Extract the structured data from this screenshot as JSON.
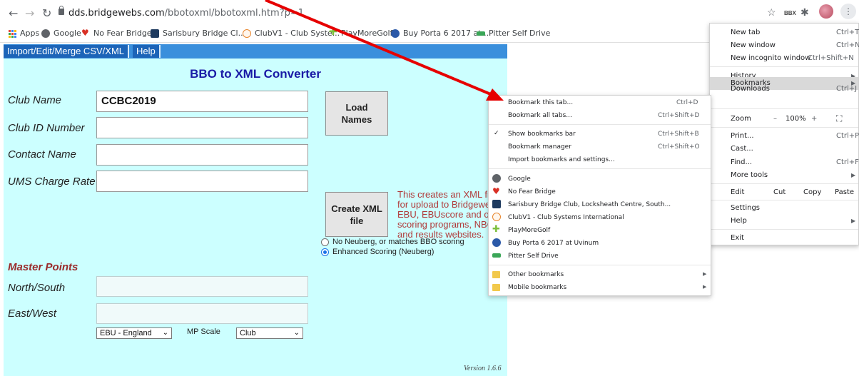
{
  "browser": {
    "url_host": "dds.bridgewebs.com",
    "url_path": "/bbotoxml/bbotoxml.htm?p=1",
    "extension_label": "BBX"
  },
  "bookmarks_bar": [
    {
      "label": "Apps",
      "icon": "apps-grid-icon",
      "color": "#4285f4"
    },
    {
      "label": "Google",
      "icon": "google-globe-icon",
      "color": "#5f6368"
    },
    {
      "label": "No Fear Bridge",
      "icon": "heart-icon",
      "color": "#d93025"
    },
    {
      "label": "Sarisbury Bridge Cl...",
      "icon": "club-logo-icon",
      "color": "#1e3a5f"
    },
    {
      "label": "ClubV1 - Club Syste...",
      "icon": "clubv1-logo-icon",
      "color": "#e8862e"
    },
    {
      "label": "PlayMoreGolf",
      "icon": "golf-cross-icon",
      "color": "#7cbf3c"
    },
    {
      "label": "Buy Porta 6 2017 at...",
      "icon": "uvinum-icon",
      "color": "#2b59a8"
    },
    {
      "label": "Pitter Self Drive",
      "icon": "pitter-icon",
      "color": "#3aa657"
    }
  ],
  "page": {
    "menu_tabs": [
      "Import/Edit/Merge CSV/XML",
      "Help"
    ],
    "title": "BBO to XML Converter",
    "fields": {
      "club_name": {
        "label": "Club Name",
        "value": "CCBC2019"
      },
      "club_id": {
        "label": "Club ID Number",
        "value": ""
      },
      "contact": {
        "label": "Contact Name",
        "value": ""
      },
      "ums": {
        "label": "UMS Charge Rate",
        "value": ""
      }
    },
    "load_names_label": "Load Names",
    "create_xml_label": "Create XML file",
    "info_lines": [
      "This creates an XML fil",
      "for upload to Bridgewe",
      "EBU, EBUscore and ot",
      "scoring programs, NBO",
      "and results websites."
    ],
    "scoring_options": [
      {
        "label": "No Neuberg, or matches BBO scoring",
        "selected": false
      },
      {
        "label": "Enhanced Scoring (Neuberg)",
        "selected": true
      }
    ],
    "master_points": {
      "heading": "Master Points",
      "ns_label": "North/South",
      "ew_label": "East/West",
      "region": "EBU - England",
      "mp_scale_label": "MP Scale",
      "mp_scale": "Club"
    },
    "version": "Version 1.6.6"
  },
  "chrome_menu": {
    "new_tab": {
      "label": "New tab",
      "key": "Ctrl+T"
    },
    "new_window": {
      "label": "New window",
      "key": "Ctrl+N"
    },
    "incognito": {
      "label": "New incognito window",
      "key": "Ctrl+Shift+N"
    },
    "history": "History",
    "downloads": {
      "label": "Downloads",
      "key": "Ctrl+J"
    },
    "bookmarks": "Bookmarks",
    "zoom": {
      "label": "Zoom",
      "minus": "–",
      "value": "100%",
      "plus": "+"
    },
    "print": {
      "label": "Print...",
      "key": "Ctrl+P"
    },
    "cast": "Cast...",
    "find": {
      "label": "Find...",
      "key": "Ctrl+F"
    },
    "more_tools": "More tools",
    "edit": {
      "label": "Edit",
      "cut": "Cut",
      "copy": "Copy",
      "paste": "Paste"
    },
    "settings": "Settings",
    "help": "Help",
    "exit": "Exit"
  },
  "bookmarks_menu": {
    "bookmark_tab": {
      "label": "Bookmark this tab...",
      "key": "Ctrl+D"
    },
    "bookmark_all": {
      "label": "Bookmark all tabs...",
      "key": "Ctrl+Shift+D"
    },
    "show_bar": {
      "label": "Show bookmarks bar",
      "key": "Ctrl+Shift+B",
      "checked": true
    },
    "manager": {
      "label": "Bookmark manager",
      "key": "Ctrl+Shift+O"
    },
    "import": "Import bookmarks and settings...",
    "items": [
      {
        "label": "Google",
        "icon": "google-globe-icon",
        "color": "#5f6368"
      },
      {
        "label": "No Fear Bridge",
        "icon": "heart-icon",
        "color": "#d93025"
      },
      {
        "label": "Sarisbury Bridge Club, Locksheath Centre, South...",
        "icon": "club-logo-icon",
        "color": "#1e3a5f"
      },
      {
        "label": "ClubV1 - Club Systems International",
        "icon": "clubv1-logo-icon",
        "color": "#e8862e"
      },
      {
        "label": "PlayMoreGolf",
        "icon": "golf-cross-icon",
        "color": "#7cbf3c"
      },
      {
        "label": "Buy Porta 6 2017 at Uvinum",
        "icon": "uvinum-icon",
        "color": "#2b59a8"
      },
      {
        "label": "Pitter Self Drive",
        "icon": "pitter-icon",
        "color": "#3aa657"
      }
    ],
    "other": "Other bookmarks",
    "mobile": "Mobile bookmarks"
  },
  "annotation_color": "#e60000"
}
